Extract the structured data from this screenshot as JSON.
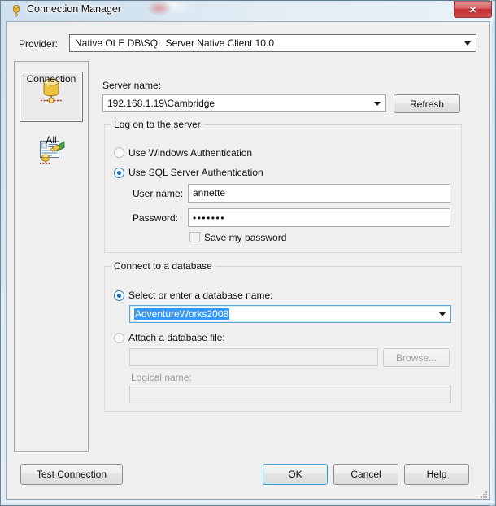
{
  "window": {
    "title": "Connection Manager",
    "icon": "database-icon",
    "close_label": "✕"
  },
  "provider": {
    "label": "Provider:",
    "value": "Native OLE DB\\SQL Server Native Client 10.0"
  },
  "sidebar": {
    "items": [
      {
        "label": "Connection",
        "icon": "database-connection-icon",
        "selected": true
      },
      {
        "label": "All",
        "icon": "all-properties-icon",
        "selected": false
      }
    ]
  },
  "server": {
    "label": "Server name:",
    "value": "192.168.1.19\\Cambridge",
    "refresh_label": "Refresh"
  },
  "logon": {
    "group_title": "Log on to the server",
    "windows_auth_label": "Use Windows Authentication",
    "sql_auth_label": "Use SQL Server Authentication",
    "username_label": "User name:",
    "username_value": "annette",
    "password_label": "Password:",
    "password_value": "•••••••",
    "save_password_label": "Save my password"
  },
  "database": {
    "group_title": "Connect to a database",
    "select_label": "Select or enter a database name:",
    "select_value": "AdventureWorks2008",
    "attach_label": "Attach a database file:",
    "attach_value": "",
    "browse_label": "Browse...",
    "logical_label": "Logical name:",
    "logical_value": ""
  },
  "footer": {
    "test_label": "Test Connection",
    "ok_label": "OK",
    "cancel_label": "Cancel",
    "help_label": "Help"
  },
  "colors": {
    "accent": "#3399ff",
    "focus_border": "#3d9cd2",
    "close_red": "#c22f2f"
  }
}
